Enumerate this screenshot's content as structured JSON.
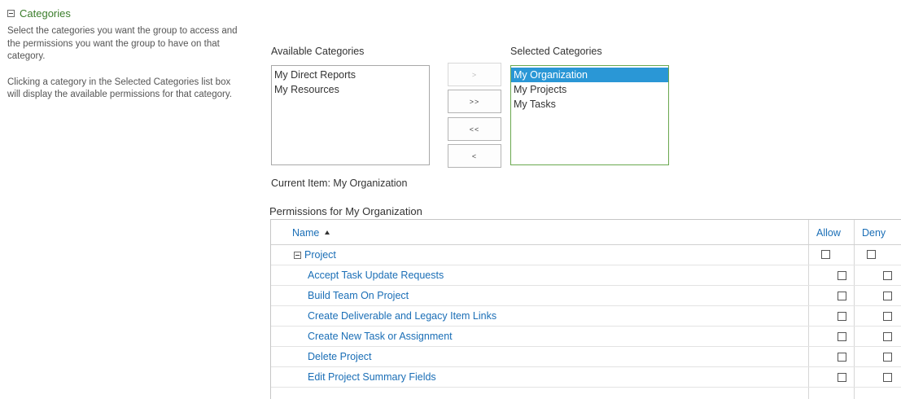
{
  "section": {
    "title": "Categories",
    "description_1": "Select the categories you want the group to access and the permissions you want the group to have on that category.",
    "description_2": "Clicking a category in the Selected Categories list box will display the available permissions for that category."
  },
  "available": {
    "label": "Available Categories",
    "options": [
      "My Direct Reports",
      "My Resources"
    ]
  },
  "selected": {
    "label": "Selected Categories",
    "options": [
      "My Organization",
      "My Projects",
      "My Tasks"
    ],
    "selected_index": 0
  },
  "buttons": {
    "add": ">",
    "add_all": ">>",
    "remove_all": "<<",
    "remove": "<"
  },
  "current_item": "Current Item: My Organization",
  "permissions": {
    "title": "Permissions for My Organization",
    "columns": {
      "name": "Name",
      "allow": "Allow",
      "deny": "Deny"
    },
    "group": "Project",
    "items": [
      "Accept Task Update Requests",
      "Build Team On Project",
      "Create Deliverable and Legacy Item Links",
      "Create New Task or Assignment",
      "Delete Project",
      "Edit Project Summary Fields"
    ]
  },
  "colors": {
    "link": "#1a6eb6",
    "section_title": "#3b7d2b",
    "selection": "#2a97d6",
    "selected_box_border": "#6aa84f"
  }
}
